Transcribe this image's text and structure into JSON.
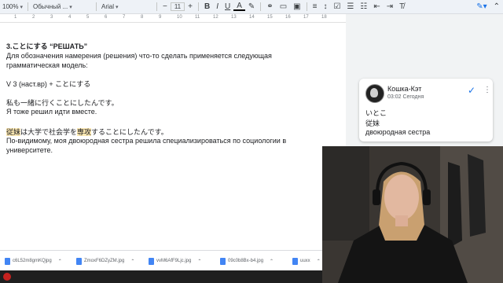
{
  "toolbar": {
    "zoom": "100%",
    "style": "Обычный ...",
    "font": "Arial",
    "font_size": "11",
    "bold": "B",
    "italic": "I",
    "underline": "U",
    "text_color": "A"
  },
  "ruler": [
    "1",
    "2",
    "3",
    "4",
    "5",
    "6",
    "7",
    "8",
    "9",
    "10",
    "11",
    "12",
    "13",
    "14",
    "15",
    "16",
    "17",
    "18"
  ],
  "doc": {
    "heading": "3.ことにする “РЕШАТЬ”",
    "intro_1": "Для обозначения намерения (решения) что-то сделать применяется следующая",
    "intro_2": "грамматическая модель:",
    "pattern": "V 3 (наст.вр) + ことにする",
    "ex1_jp": "私も一緒に行くことにしたんです。",
    "ex1_ru": "Я тоже решил идти вместе.",
    "ex2_jp_hl1": "従妹",
    "ex2_jp_a": "は大学で社会学を",
    "ex2_jp_hl2": "専攻",
    "ex2_jp_b": "することにしたんです。",
    "ex2_ru_1": "По-видимому, моя двоюродная сестра решила специализироваться по социологии в",
    "ex2_ru_2": "университете."
  },
  "comment": {
    "author": "Кошка-Кэт",
    "time": "03:02 Сегодня",
    "line1": "いとこ",
    "line2": "従妹",
    "line3": "двоюродная сестра"
  },
  "downloads": [
    "c6L52m8gmKQjpg",
    "ZmoxF6DZyZM.jpg",
    "vvM6AfF9Ljc.jpg",
    "09c0b8Bx-b4.jpg",
    "uuxx"
  ],
  "colors": {
    "highlight": "#fce8b2",
    "accent": "#1a73e8"
  }
}
